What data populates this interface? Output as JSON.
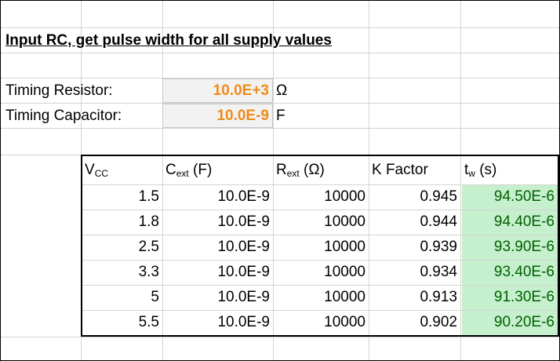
{
  "title": "Input RC, get pulse width for all supply values",
  "inputs": {
    "resistor_label": "Timing Resistor:",
    "resistor_value": "10.0E+3",
    "resistor_unit": "Ω",
    "capacitor_label": "Timing Capacitor:",
    "capacitor_value": "10.0E-9",
    "capacitor_unit": "F"
  },
  "table": {
    "headers": {
      "vcc_main": "V",
      "vcc_sub": "CC",
      "cext_main": "C",
      "cext_sub": "ext",
      "cext_tail": " (F)",
      "rext_main": "R",
      "rext_sub": "ext",
      "rext_tail": " (Ω)",
      "kfactor": "K Factor",
      "tw_main": "t",
      "tw_sub": "w",
      "tw_tail": " (s)"
    },
    "rows": [
      {
        "vcc": "1.5",
        "cext": "10.0E-9",
        "rext": "10000",
        "k": "0.945",
        "tw": "94.50E-6"
      },
      {
        "vcc": "1.8",
        "cext": "10.0E-9",
        "rext": "10000",
        "k": "0.944",
        "tw": "94.40E-6"
      },
      {
        "vcc": "2.5",
        "cext": "10.0E-9",
        "rext": "10000",
        "k": "0.939",
        "tw": "93.90E-6"
      },
      {
        "vcc": "3.3",
        "cext": "10.0E-9",
        "rext": "10000",
        "k": "0.934",
        "tw": "93.40E-6"
      },
      {
        "vcc": "5",
        "cext": "10.0E-9",
        "rext": "10000",
        "k": "0.913",
        "tw": "91.30E-6"
      },
      {
        "vcc": "5.5",
        "cext": "10.0E-9",
        "rext": "10000",
        "k": "0.902",
        "tw": "90.20E-6"
      }
    ]
  },
  "colors": {
    "input_text": "#f08a1c",
    "input_fill": "#f2f2f2",
    "result_fill": "#c6efce",
    "result_text": "#006100",
    "gridline": "#d4d4d4"
  }
}
